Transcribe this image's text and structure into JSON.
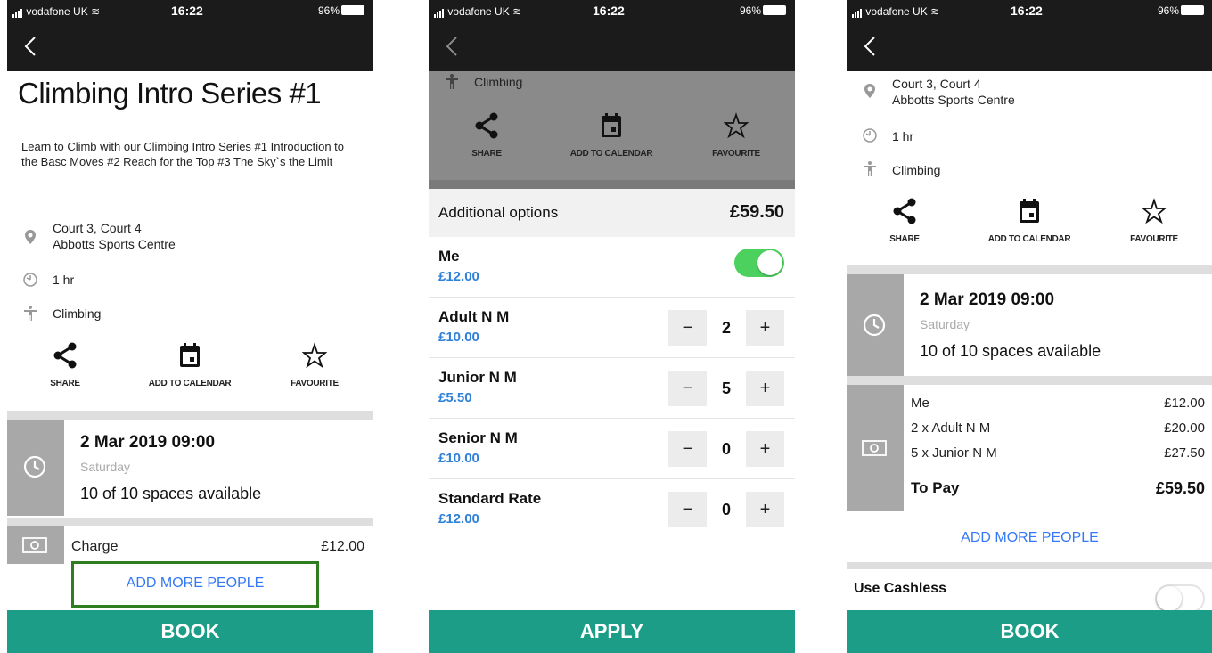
{
  "status": {
    "carrier": "vodafone UK",
    "time": "16:22",
    "battery": "96%"
  },
  "screen1": {
    "title": "Climbing Intro Series #1",
    "description": "Learn to Climb with our Climbing Intro Series #1 Introduction to the Basc Moves #2 Reach for the Top #3 The Sky`s the Limit",
    "location_line1": "Court 3, Court 4",
    "location_line2": "Abbotts Sports Centre",
    "duration": "1 hr",
    "activity": "Climbing",
    "actions": {
      "share": "SHARE",
      "calendar": "ADD TO CALENDAR",
      "favourite": "FAVOURITE"
    },
    "date": "2 Mar 2019  09:00",
    "day": "Saturday",
    "availability": "10 of 10 spaces available",
    "charge_label": "Charge",
    "charge_amount": "£12.00",
    "add_more": "ADD MORE PEOPLE",
    "book": "BOOK"
  },
  "screen2": {
    "activity": "Climbing",
    "actions": {
      "share": "SHARE",
      "calendar": "ADD TO CALENDAR",
      "favourite": "FAVOURITE"
    },
    "header_label": "Additional options",
    "header_total": "£59.50",
    "options": [
      {
        "name": "Me",
        "price": "£12.00",
        "toggle": true
      },
      {
        "name": "Adult N M",
        "price": "£10.00",
        "qty": "2"
      },
      {
        "name": "Junior N M",
        "price": "£5.50",
        "qty": "5"
      },
      {
        "name": "Senior N M",
        "price": "£10.00",
        "qty": "0"
      },
      {
        "name": "Standard Rate",
        "price": "£12.00",
        "qty": "0"
      }
    ],
    "minus": "−",
    "plus": "+",
    "apply": "APPLY"
  },
  "screen3": {
    "location_line1": "Court 3, Court 4",
    "location_line2": "Abbotts Sports Centre",
    "duration": "1 hr",
    "activity": "Climbing",
    "actions": {
      "share": "SHARE",
      "calendar": "ADD TO CALENDAR",
      "favourite": "FAVOURITE"
    },
    "date": "2 Mar 2019  09:00",
    "day": "Saturday",
    "availability": "10 of 10 spaces available",
    "summary": [
      {
        "label": "Me",
        "amount": "£12.00"
      },
      {
        "label": "2 x Adult N M",
        "amount": "£20.00"
      },
      {
        "label": "5 x Junior N M",
        "amount": "£27.50"
      }
    ],
    "to_pay_label": "To Pay",
    "to_pay_amount": "£59.50",
    "add_more": "ADD MORE PEOPLE",
    "cashless_label": "Use Cashless",
    "book": "BOOK"
  },
  "colors": {
    "accent": "#1c9d87",
    "link": "#3478f6",
    "toggle_on": "#4cd05e",
    "highlight": "#2e7d1f"
  }
}
